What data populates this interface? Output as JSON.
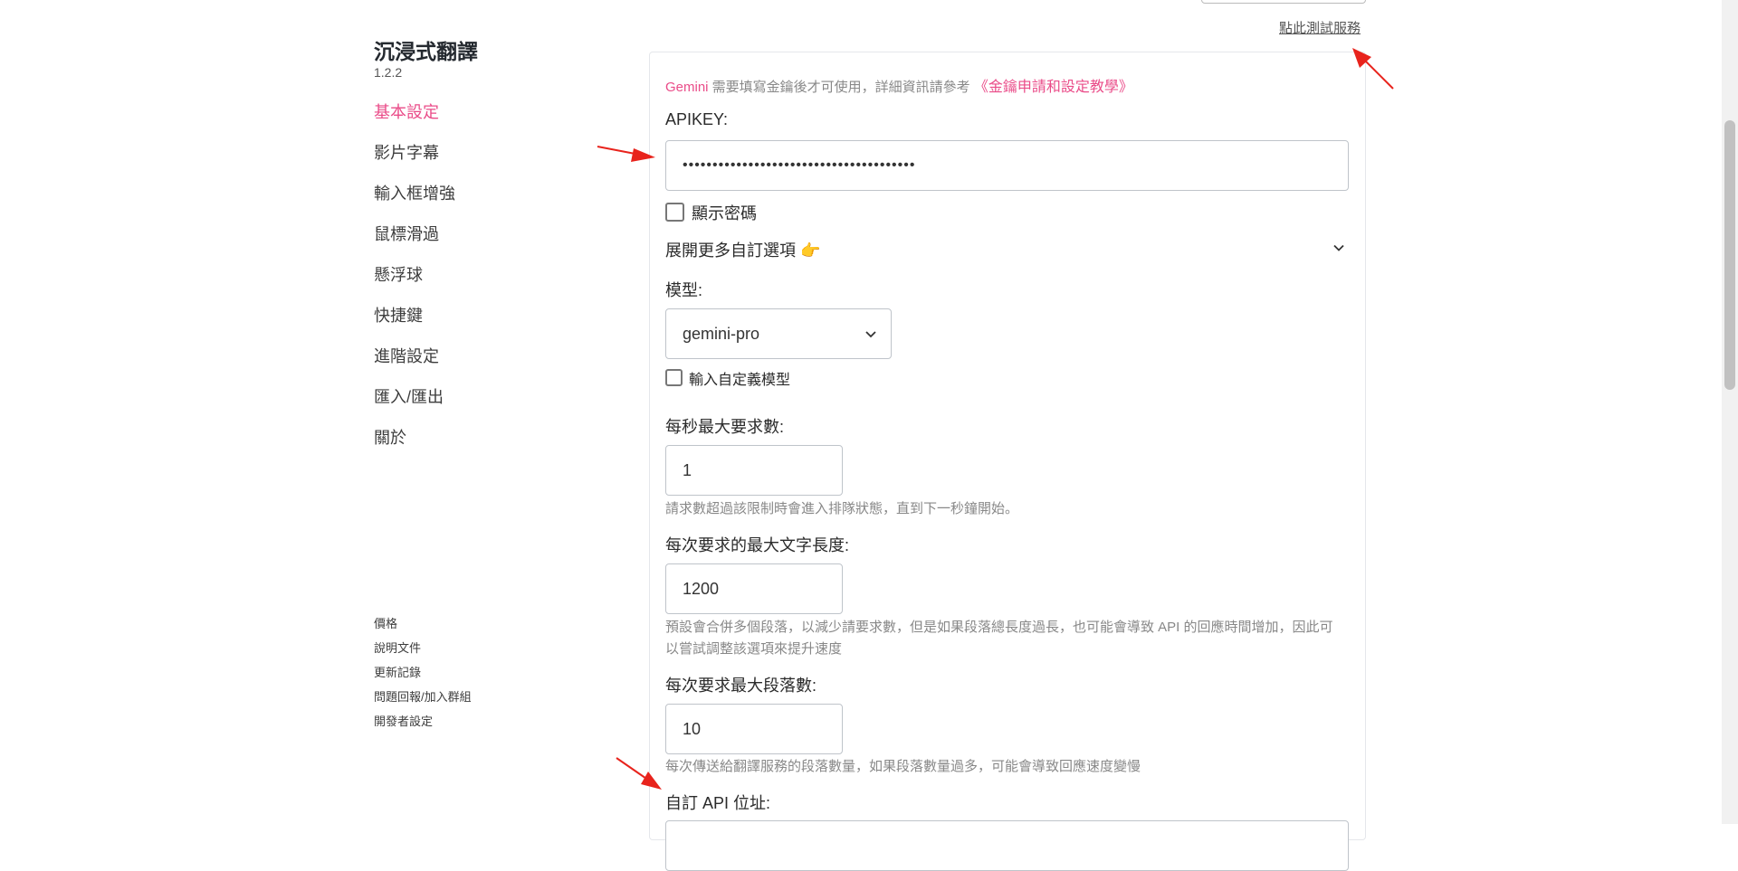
{
  "brand": {
    "title": "沉浸式翻譯",
    "version": "1.2.2"
  },
  "sidebar": {
    "items": [
      {
        "label": "基本設定"
      },
      {
        "label": "影片字幕"
      },
      {
        "label": "輸入框增強"
      },
      {
        "label": "鼠標滑過"
      },
      {
        "label": "懸浮球"
      },
      {
        "label": "快捷鍵"
      },
      {
        "label": "進階設定"
      },
      {
        "label": "匯入/匯出"
      },
      {
        "label": "關於"
      }
    ],
    "footer": [
      {
        "label": "價格"
      },
      {
        "label": "說明文件"
      },
      {
        "label": "更新記錄"
      },
      {
        "label": "問題回報/加入群組"
      },
      {
        "label": "開發者設定"
      }
    ]
  },
  "header": {
    "test_link": "點此測試服務"
  },
  "form": {
    "notice_service": "Gemini",
    "notice_text": " 需要填寫金鑰後才可使用，詳細資訊請參考 ",
    "notice_link": "《金鑰申請和設定教學》",
    "apikey_label": "APIKEY:",
    "apikey_value": "•••••••••••••••••••••••••••••••••••••••",
    "show_password_label": "顯示密碼",
    "expand_label": "展開更多自訂選項 👉",
    "model_label": "模型:",
    "model_selected": "gemini-pro",
    "custom_model_label": "輸入自定義模型",
    "rps_label": "每秒最大要求數:",
    "rps_value": "1",
    "rps_help": "請求數超過該限制時會進入排隊狀態，直到下一秒鐘開始。",
    "max_text_label": "每次要求的最大文字長度:",
    "max_text_value": "1200",
    "max_text_help": "預設會合併多個段落，以減少請要求數，但是如果段落總長度過長，也可能會導致 API 的回應時間增加，因此可以嘗試調整該選項來提升速度",
    "max_para_label": "每次要求最大段落數:",
    "max_para_value": "10",
    "max_para_help": "每次傳送給翻譯服務的段落數量，如果段落數量過多，可能會導致回應速度變慢",
    "custom_api_label": "自訂 API 位址:"
  },
  "colors": {
    "accent": "#ea4c89",
    "annotation_arrow": "#e8231c"
  },
  "icons": {
    "dropdown": "chevron-down-icon",
    "expand": "chevron-down-icon",
    "annotation": "red-arrow-icon"
  }
}
